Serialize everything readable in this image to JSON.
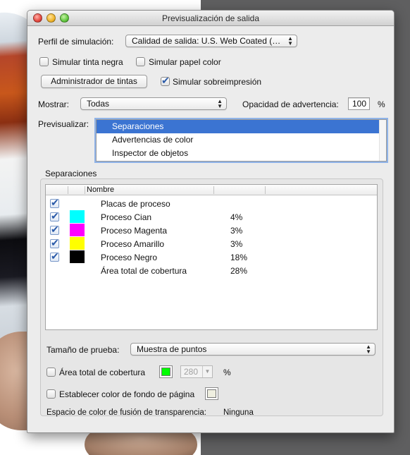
{
  "window": {
    "title": "Previsualización de salida"
  },
  "perfil": {
    "label": "Perfil de simulación:",
    "value": "Calidad de salida: U.S. Web Coated (SW..."
  },
  "options": {
    "simular_tinta_negra": {
      "label": "Simular tinta negra",
      "checked": false
    },
    "simular_papel_color": {
      "label": "Simular papel color",
      "checked": false
    },
    "simular_sobreimpresion": {
      "label": "Simular sobreimpresión",
      "checked": true
    }
  },
  "admin_button": "Administrador de tintas",
  "mostrar": {
    "label": "Mostrar:",
    "value": "Todas"
  },
  "opacidad": {
    "label": "Opacidad de advertencia:",
    "value": "100",
    "unit": "%"
  },
  "previsualizar": {
    "label": "Previsualizar:",
    "items": [
      "Separaciones",
      "Advertencias de color",
      "Inspector de objetos"
    ],
    "selected_index": 0
  },
  "separaciones": {
    "section_label": "Separaciones",
    "columns": [
      "",
      "",
      "Nombre",
      "",
      ""
    ],
    "rows": [
      {
        "checked": true,
        "color": "",
        "name": "Placas de proceso",
        "percent": ""
      },
      {
        "checked": true,
        "color": "#00ffff",
        "name": "Proceso Cian",
        "percent": "4%"
      },
      {
        "checked": true,
        "color": "#ff00ff",
        "name": "Proceso Magenta",
        "percent": "3%"
      },
      {
        "checked": true,
        "color": "#ffff00",
        "name": "Proceso Amarillo",
        "percent": "3%"
      },
      {
        "checked": true,
        "color": "#000000",
        "name": "Proceso Negro",
        "percent": "18%"
      },
      {
        "checked": false,
        "color": "",
        "name": "Área total de cobertura",
        "percent": "28%"
      }
    ]
  },
  "tamano_prueba": {
    "label": "Tamaño de prueba:",
    "value": "Muestra de puntos"
  },
  "area_total": {
    "label": "Área total de cobertura",
    "checked": false,
    "color": "#00ff00",
    "value": "280",
    "unit": "%"
  },
  "fondo_pagina": {
    "label": "Establecer color de fondo de página",
    "checked": false,
    "color": "#efefe0"
  },
  "transparencia": {
    "label": "Espacio de color de fusión de transparencia:",
    "value": "Ninguna"
  }
}
